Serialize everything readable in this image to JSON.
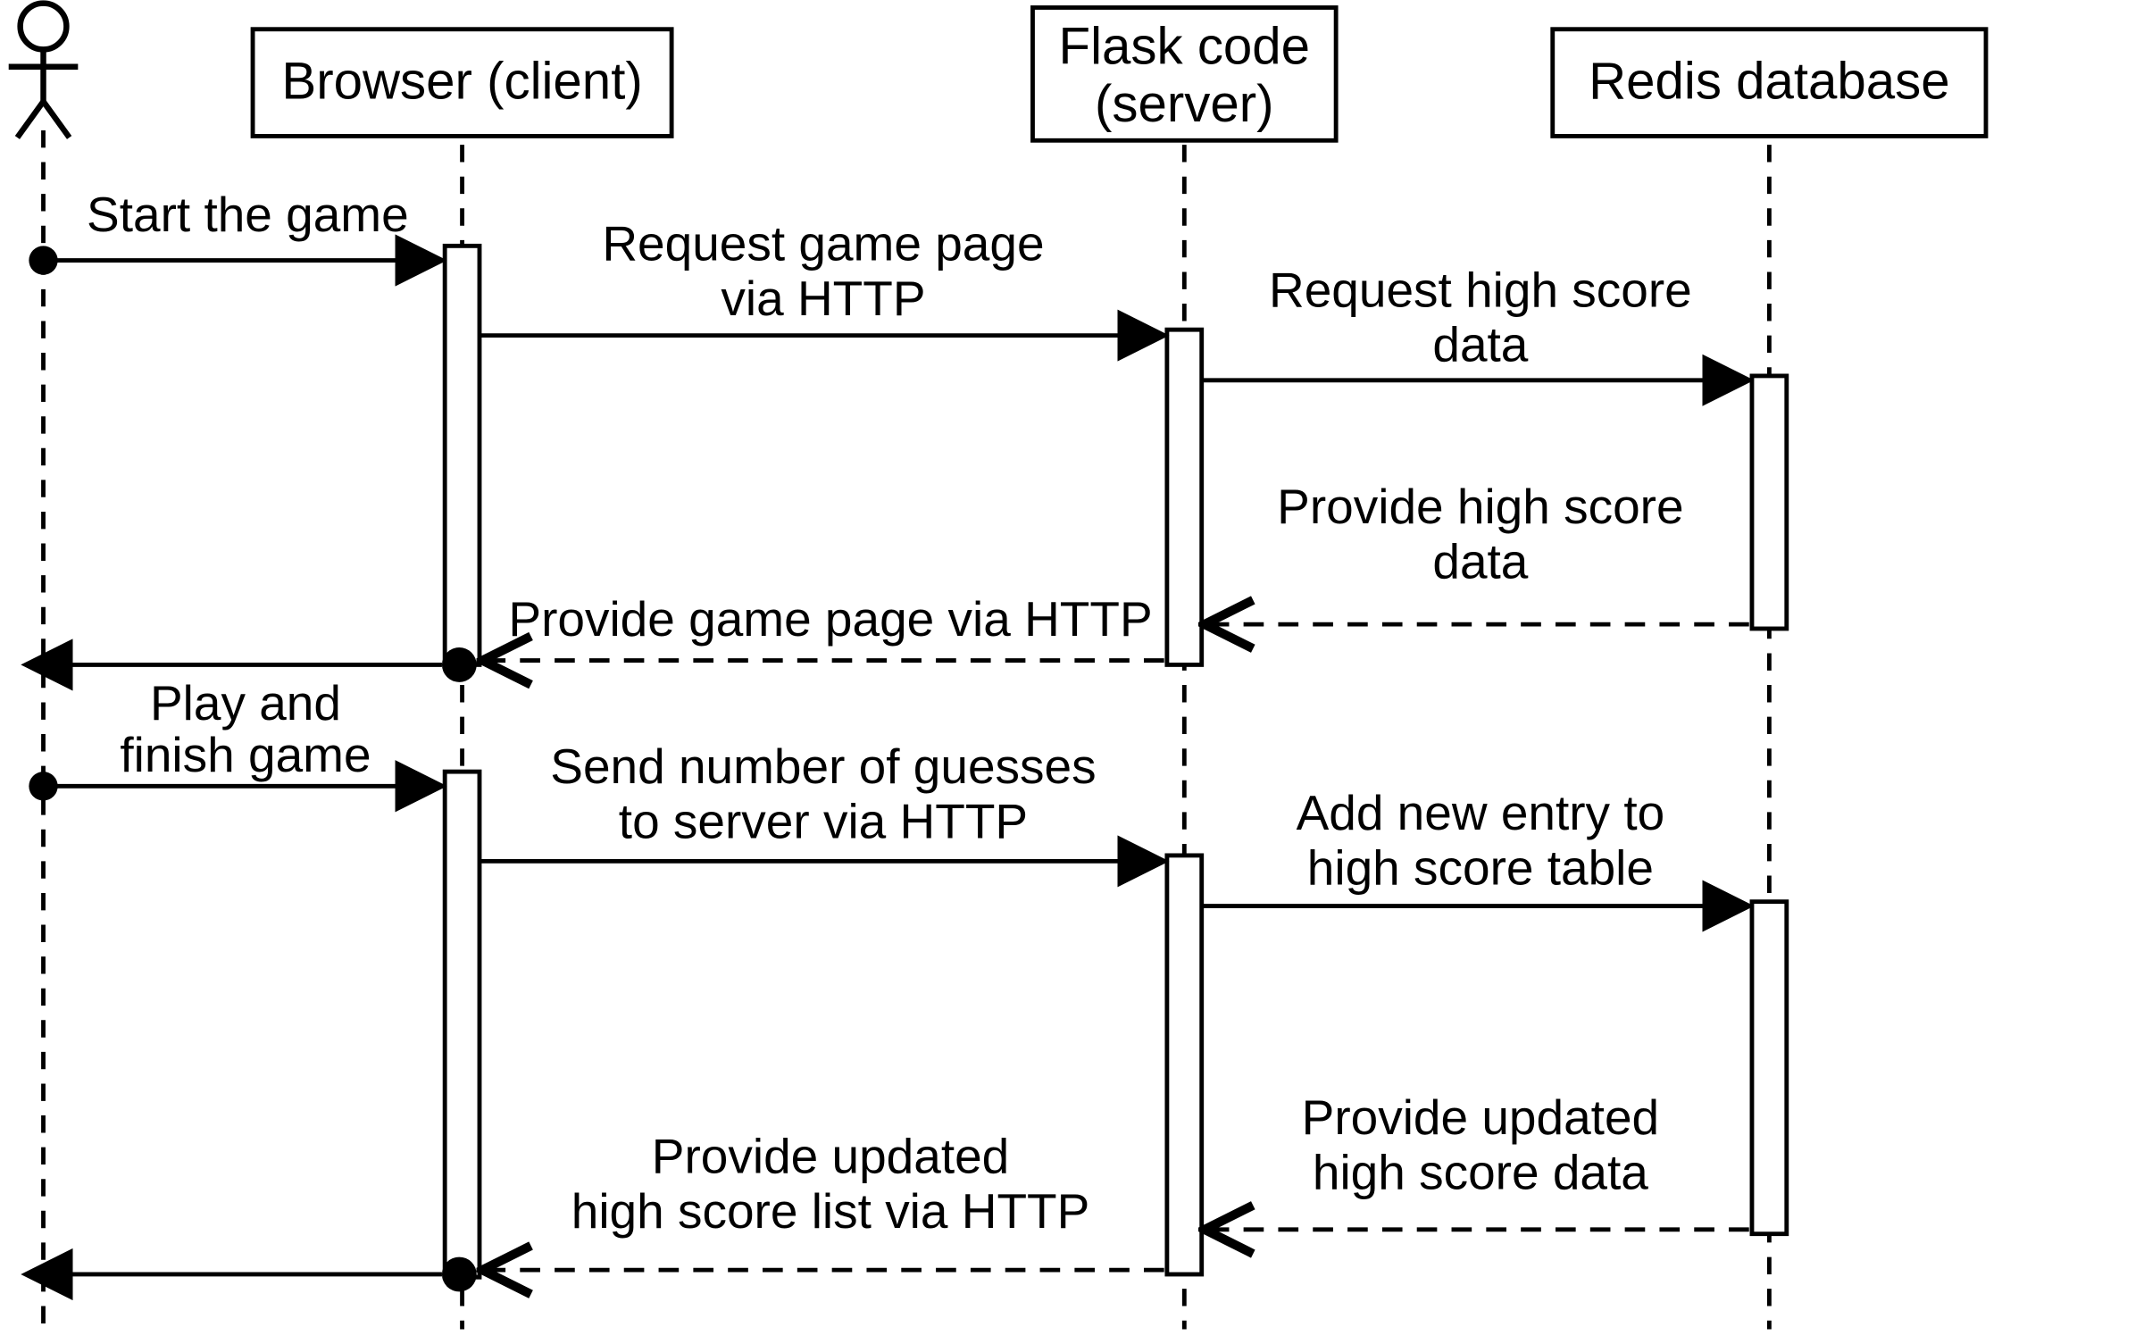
{
  "participants": {
    "actor": {
      "label": ""
    },
    "browser": {
      "label": "Browser (client)"
    },
    "flask": {
      "label1": "Flask code",
      "label2": "(server)"
    },
    "redis": {
      "label": "Redis database"
    }
  },
  "messages": {
    "m1": "Start the game",
    "m2a": "Request game page",
    "m2b": "via HTTP",
    "m3a": "Request high score",
    "m3b": "data",
    "m4a": "Provide high score",
    "m4b": "data",
    "m5": "Provide game page via HTTP",
    "m7a": "Play and",
    "m7b": "finish game",
    "m8a": "Send number of guesses",
    "m8b": "to server via HTTP",
    "m9a": "Add new entry to",
    "m9b": "high score table",
    "m10a": "Provide updated",
    "m10b": "high score data",
    "m11a": "Provide updated",
    "m11b": "high score list via HTTP"
  }
}
